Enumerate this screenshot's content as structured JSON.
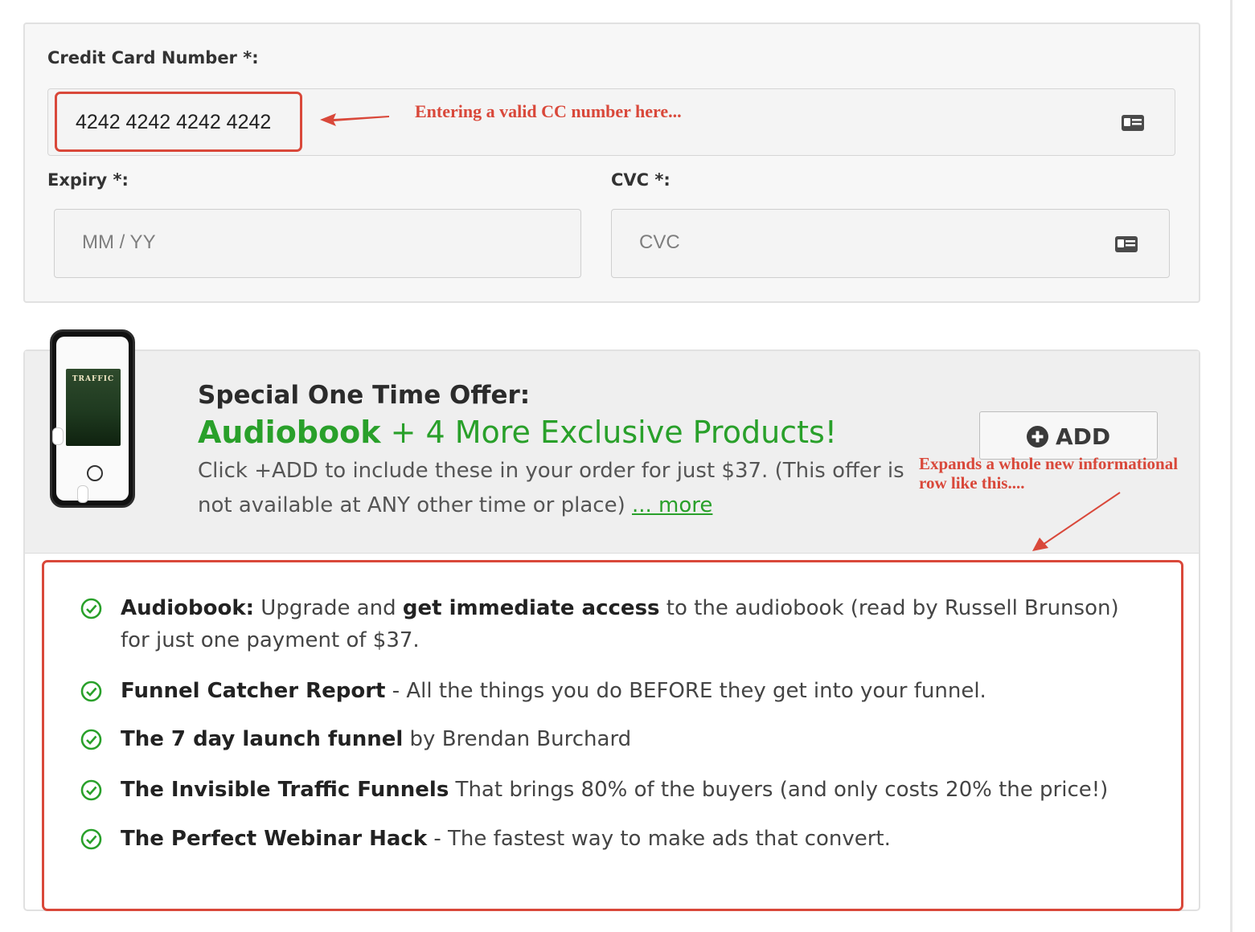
{
  "card_form": {
    "cc_label": "Credit Card Number *:",
    "cc_value": "4242 4242 4242 4242",
    "expiry_label": "Expiry *:",
    "expiry_placeholder": "MM / YY",
    "cvc_label": "CVC *:",
    "cvc_placeholder": "CVC"
  },
  "annotations": {
    "cc_note": "Entering a valid CC number here...",
    "expand_note_line1": "Expands a whole new informational",
    "expand_note_line2": "row like this....",
    "accent_color": "#d9483a"
  },
  "offer": {
    "title": "Special One Time Offer:",
    "subtitle_bold": "Audiobook",
    "subtitle_rest": " + 4 More Exclusive Products!",
    "description": "Click +ADD to include these in your order for just $37. (This offer is not available at ANY other time or place) ",
    "more_link": "... more",
    "add_button": "ADD",
    "book_title": "TRAFFIC",
    "accent_color": "#29a02a"
  },
  "bullets": [
    {
      "bold": "Audiobook:",
      "text1": " Upgrade and ",
      "bold2": "get immediate access",
      "text2": " to the audiobook (read by Russell Brunson) for just one payment of $37."
    },
    {
      "bold": "Funnel Catcher Report",
      "text1": " - All the things you do BEFORE they get into your funnel.",
      "bold2": "",
      "text2": ""
    },
    {
      "bold": "The 7 day launch funnel",
      "text1": " by Brendan Burchard",
      "bold2": "",
      "text2": ""
    },
    {
      "bold": "The Invisible Traffic Funnels",
      "text1": " That brings 80% of the buyers (and only costs 20% the price!)",
      "bold2": "",
      "text2": ""
    },
    {
      "bold": "The Perfect Webinar Hack",
      "text1": " - The fastest way to make ads that convert.",
      "bold2": "",
      "text2": ""
    }
  ]
}
